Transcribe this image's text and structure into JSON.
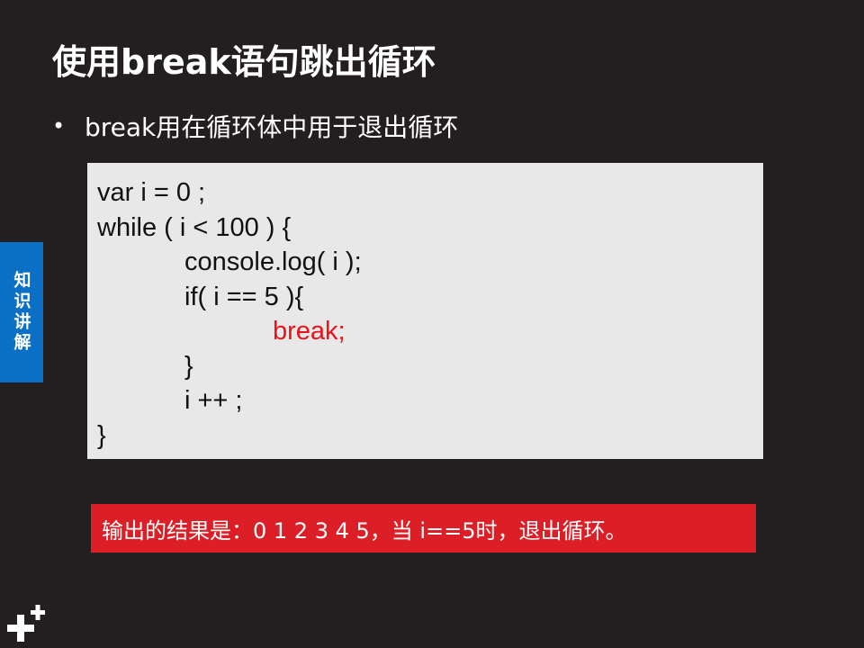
{
  "slide": {
    "title": "使用break语句跳出循环",
    "bullet_symbol": "•",
    "bullet_text": "break用在循环体中用于退出循环",
    "code_lines": [
      "var i = 0 ;",
      "while ( i < 100 ) {",
      "console.log( i );",
      "if( i == 5 ){",
      "break;",
      "}",
      "i ++ ;",
      "}"
    ],
    "result_text": "输出的结果是：0 1 2 3 4 5，当 i==5时，退出循环。",
    "side_tab_label": "知识讲解"
  },
  "colors": {
    "background": "#231f20",
    "code_bg": "#e8e8e8",
    "highlight_red": "#e8131b",
    "result_bg": "#dc1f26",
    "side_tab_blue": "#0b6fc6"
  },
  "icons": [
    "plus-logo-icon"
  ]
}
